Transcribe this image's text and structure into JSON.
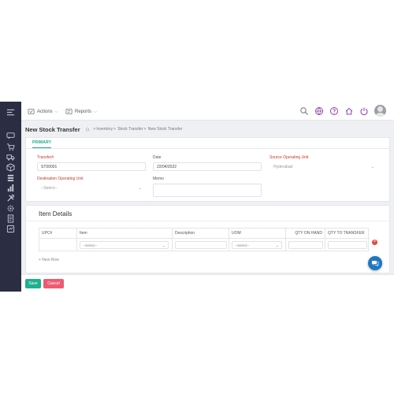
{
  "topbar": {
    "actions_label": "Actions",
    "reports_label": "Reports"
  },
  "page": {
    "title": "New Stock Transfer",
    "breadcrumb": [
      "Inventory",
      "Stock Transfer",
      "New Stock Transfer"
    ]
  },
  "primary": {
    "tab_label": "PRIMARY",
    "transfer_label": "Transfer#",
    "transfer_value": "ST00001",
    "date_label": "Date",
    "date_value": "22/04/2022",
    "source_label": "Source Operating Unit",
    "source_value": "Hyderabad",
    "destination_label": "Destination Operating Unit",
    "destination_value": "--Select--",
    "memo_label": "Memo"
  },
  "items": {
    "title": "Item Details",
    "columns": [
      "UPC#",
      "Item",
      "Description",
      "UOM",
      "QTY ON HAND",
      "QTY TO TRANSFER"
    ],
    "item_select": "--Select--",
    "uom_select": "--Select--",
    "new_row_label": "+ New Row"
  },
  "footer": {
    "save_label": "Save",
    "cancel_label": "Cancel"
  },
  "colors": {
    "sidebar": "#2b2d42",
    "accent": "#1aa688",
    "required": "#c0392b",
    "save": "#1fb08e",
    "cancel": "#ee5a72",
    "chat": "#1f77c0"
  },
  "icons": {
    "sidebar": [
      "menu-icon",
      "chat-bubble-icon",
      "cart-icon",
      "truck-icon",
      "box-icon",
      "layers-icon",
      "chart-icon",
      "tools-icon",
      "settings-icon",
      "document-icon",
      "report-icon"
    ],
    "topbar_right": [
      "search-icon",
      "globe-icon",
      "help-icon",
      "home-icon",
      "power-icon",
      "avatar"
    ]
  }
}
